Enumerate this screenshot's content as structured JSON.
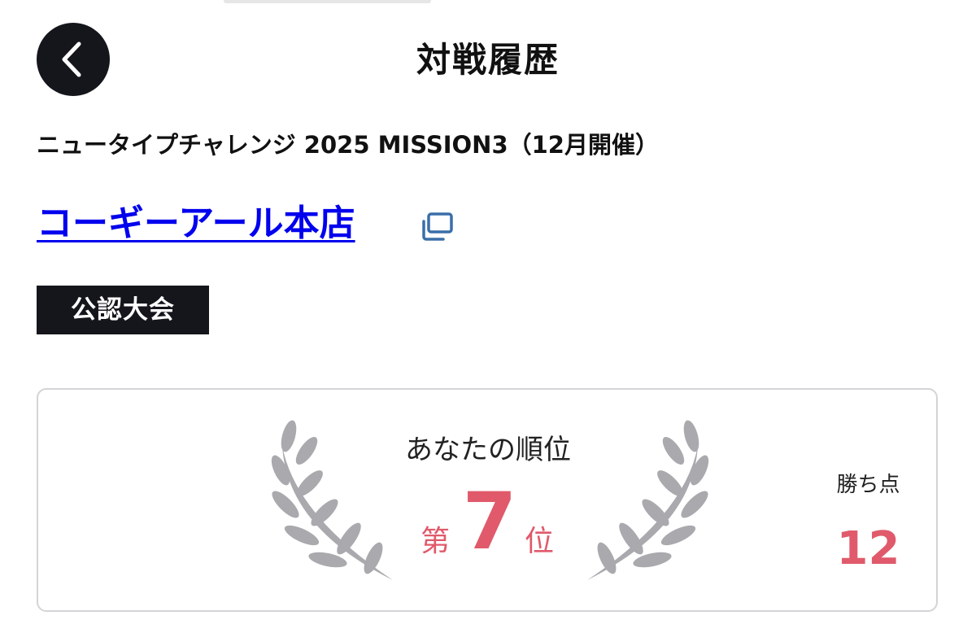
{
  "header": {
    "title": "対戦履歴",
    "back_icon": "chevron-left-icon"
  },
  "event": {
    "name": "ニュータイプチャレンジ 2025 MISSION3（12月開催）",
    "shop_name": "コーギーアール本店",
    "open_icon": "external-window-icon",
    "badge": "公認大会"
  },
  "result": {
    "heading": "あなたの順位",
    "rank_prefix": "第",
    "rank": "7",
    "rank_suffix": "位",
    "points_label": "勝ち点",
    "points": "12"
  },
  "colors": {
    "accent": "#e05a6b",
    "dark": "#14161c",
    "link": "#0000ee",
    "laurel": "#a9a9ae",
    "card_border": "#d4d4d8"
  }
}
